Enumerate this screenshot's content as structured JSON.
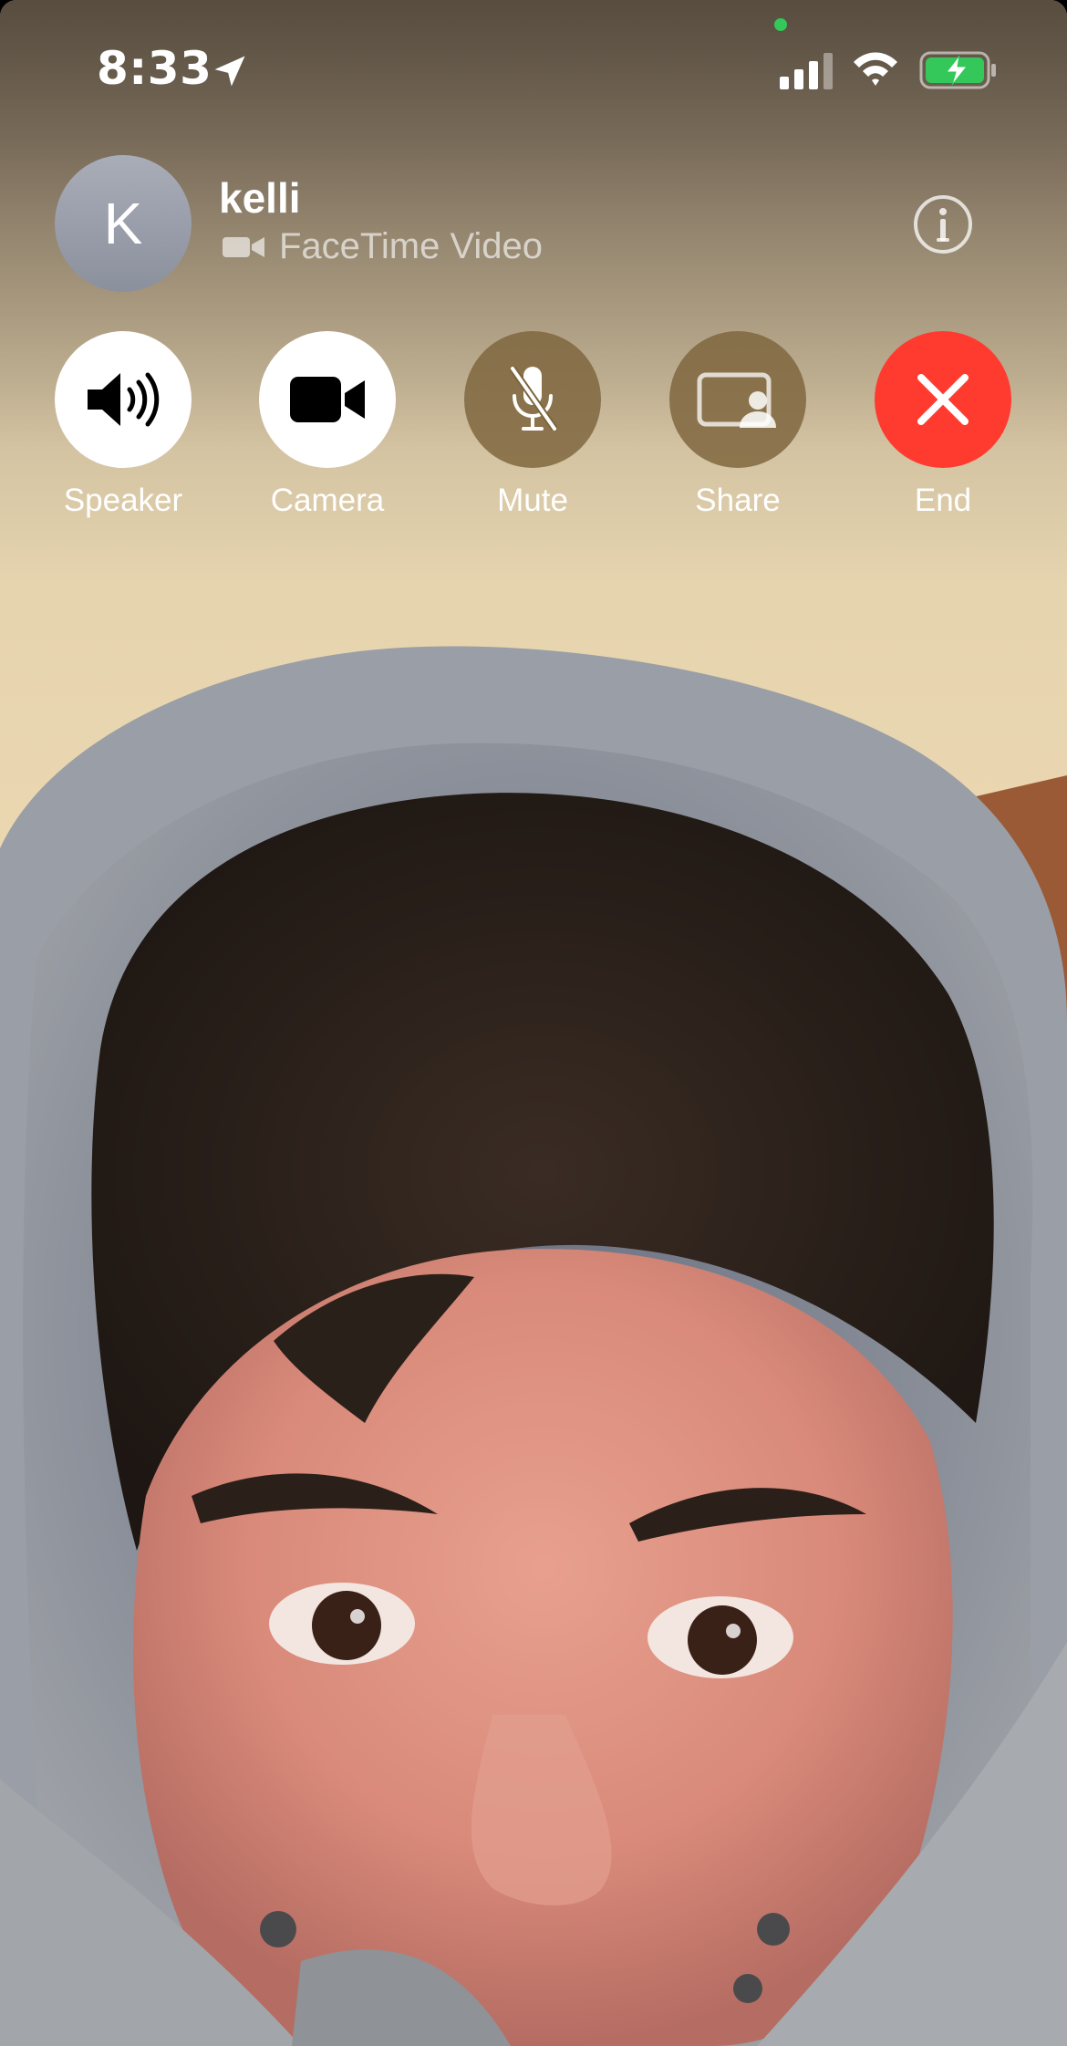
{
  "status_bar": {
    "time": "8:33",
    "icons": [
      "location-arrow-icon",
      "signal-icon",
      "wifi-icon",
      "battery-charging-icon"
    ],
    "camera_indicator_color": "#34c759"
  },
  "caller": {
    "initial": "K",
    "name": "kelli",
    "call_type": "FaceTime Video",
    "info_icon": "info-icon"
  },
  "controls": [
    {
      "label": "Speaker",
      "icon": "speaker-icon",
      "active": true
    },
    {
      "label": "Camera",
      "icon": "camera-icon",
      "active": true
    },
    {
      "label": "Mute",
      "icon": "mic-off-icon",
      "active": false
    },
    {
      "label": "Share",
      "icon": "share-screen-icon",
      "active": false
    },
    {
      "label": "End",
      "icon": "close-icon",
      "color": "#ff3b30"
    }
  ]
}
